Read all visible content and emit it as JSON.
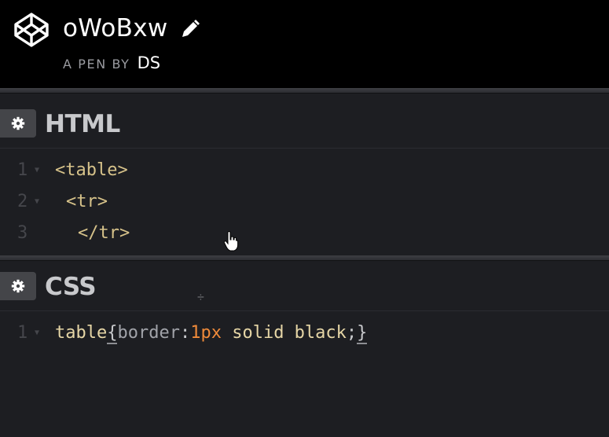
{
  "header": {
    "title": "oWoBxw",
    "byline_prefix": "A PEN BY",
    "author": "DS",
    "logo_icon": "codepen-logo-icon",
    "edit_icon": "pencil-icon"
  },
  "panels": {
    "html": {
      "title": "HTML",
      "settings_icon": "gear-icon",
      "lines": [
        {
          "number": "1",
          "parts": [
            "<table>"
          ]
        },
        {
          "number": "2",
          "parts": [
            "<tr>"
          ]
        },
        {
          "number": "3",
          "parts": [
            "</tr>"
          ]
        }
      ]
    },
    "css": {
      "title": "CSS",
      "settings_icon": "gear-icon",
      "lines": [
        {
          "number": "1",
          "selector": "table",
          "open_brace": "{",
          "property": "border",
          "colon": ":",
          "number_value": "1px",
          "rest_value": " solid black",
          "semicolon": ";",
          "close_brace": "}"
        }
      ]
    }
  },
  "colors": {
    "header_bg": "#000000",
    "editor_bg": "#1d1e22",
    "tag": "#d6c28a",
    "number": "#ef8a3a",
    "property": "#a1a3a9"
  }
}
